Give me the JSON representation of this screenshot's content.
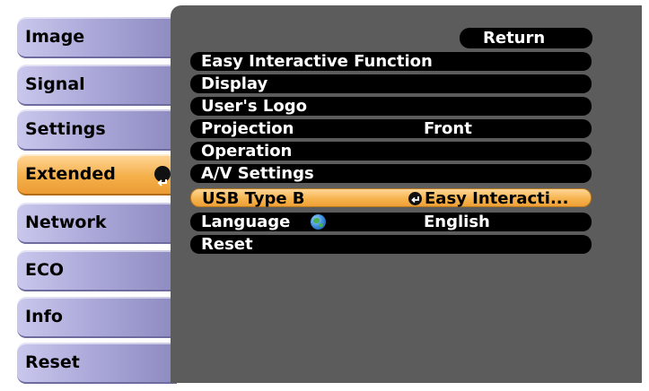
{
  "sidebar": {
    "items": [
      {
        "label": "Image"
      },
      {
        "label": "Signal"
      },
      {
        "label": "Settings"
      },
      {
        "label": "Extended",
        "selected": true
      },
      {
        "label": "Network"
      },
      {
        "label": "ECO"
      },
      {
        "label": "Info"
      },
      {
        "label": "Reset"
      }
    ]
  },
  "panel": {
    "return_label": "Return",
    "rows": [
      {
        "label": "Easy Interactive Function",
        "value": ""
      },
      {
        "label": "Display",
        "value": ""
      },
      {
        "label": "User's Logo",
        "value": ""
      },
      {
        "label": "Projection",
        "value": "Front"
      },
      {
        "label": "Operation",
        "value": ""
      },
      {
        "label": "A/V Settings",
        "value": ""
      },
      {
        "label": "USB Type B",
        "value": "Easy Interacti...",
        "selected": true
      },
      {
        "label": "Language",
        "value": "English"
      },
      {
        "label": "Reset",
        "value": ""
      }
    ]
  },
  "colors": {
    "panel_bg": "#5c5c5c",
    "tab_lavender": "#a7a4d6",
    "selection_orange": "#f5b04b",
    "row_bg": "#000000"
  },
  "icons": {
    "enter": "enter-icon",
    "globe": "globe-icon"
  }
}
